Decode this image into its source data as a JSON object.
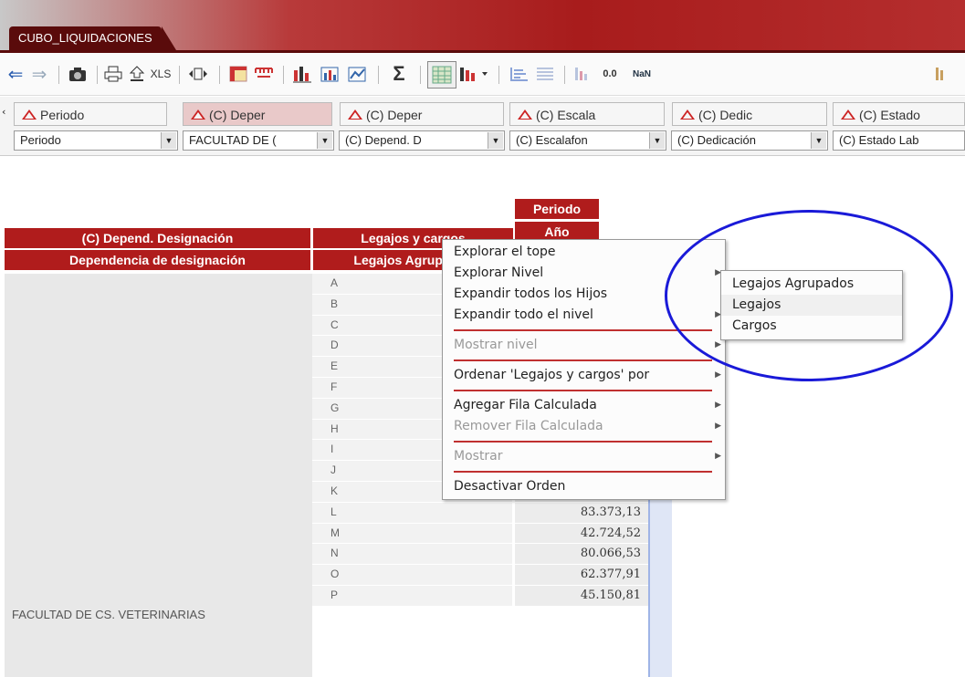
{
  "window": {
    "tab_title": "CUBO_LIQUIDACIONES"
  },
  "toolbar": {
    "xls_label": "XLS",
    "sum_label": "Σ",
    "decimal_label": "0.0",
    "nan_label": "NaN"
  },
  "dimensions": {
    "headers": [
      "Periodo",
      "(C) Deper",
      "(C) Deper",
      "(C) Escala",
      "(C) Dedic",
      "(C) Estado"
    ],
    "selects": [
      "Periodo",
      "FACULTAD DE (",
      "(C) Depend. D",
      "(C) Escalafon",
      "(C) Dedicación",
      "(C) Estado Lab"
    ]
  },
  "table": {
    "col_header_top": "Periodo",
    "col_header_year": "Año",
    "row_header_1": "(C) Depend. Designación",
    "row_header_2": "Dependencia de designación",
    "measure_header_1": "Legajos y cargos",
    "measure_header_2": "Legajos Agrupados",
    "group_label": "FACULTAD DE CS. VETERINARIAS",
    "letters": [
      "A",
      "B",
      "C",
      "D",
      "E",
      "F",
      "G",
      "H",
      "I",
      "J",
      "K",
      "L",
      "M",
      "N",
      "O",
      "P"
    ],
    "values": [
      "",
      "",
      "",
      "",
      "",
      "",
      "",
      "",
      "",
      "",
      "",
      "83.373,13",
      "42.724,52",
      "80.066,53",
      "62.377,91",
      "45.150,81"
    ]
  },
  "context_menu": {
    "items": [
      {
        "label": "Explorar el tope",
        "disabled": false,
        "submenu": false
      },
      {
        "label": "Explorar Nivel",
        "disabled": false,
        "submenu": true
      },
      {
        "label": "Expandir todos los Hijos",
        "disabled": false,
        "submenu": false
      },
      {
        "label": "Expandir todo el nivel",
        "disabled": false,
        "submenu": true
      },
      {
        "label": "Mostrar nivel",
        "disabled": true,
        "submenu": true
      },
      {
        "label": "Ordenar 'Legajos y cargos' por",
        "disabled": false,
        "submenu": true
      },
      {
        "label": "Agregar Fila Calculada",
        "disabled": false,
        "submenu": true
      },
      {
        "label": "Remover Fila Calculada",
        "disabled": true,
        "submenu": true
      },
      {
        "label": "Mostrar",
        "disabled": true,
        "submenu": true
      },
      {
        "label": "Desactivar Orden",
        "disabled": false,
        "submenu": false
      }
    ]
  },
  "submenu": {
    "items": [
      "Legajos Agrupados",
      "Legajos",
      "Cargos"
    ],
    "highlighted": "Legajos"
  },
  "colors": {
    "accent": "#b01c1c",
    "annotation": "#1a1ad8"
  }
}
